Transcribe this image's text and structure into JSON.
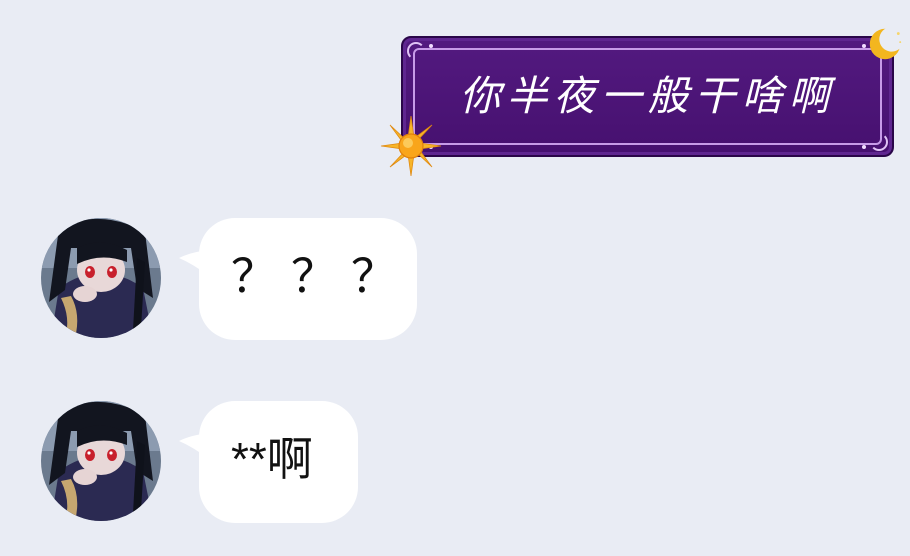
{
  "chat": {
    "outgoing": {
      "text": "你半夜一般干啥啊",
      "bubble_style": "purple-ornate",
      "decorations": [
        "moon-icon",
        "sun-icon"
      ]
    },
    "incoming": [
      {
        "text": "？？？",
        "avatar": "anime-girl-avatar"
      },
      {
        "text": "**啊",
        "avatar": "anime-girl-avatar"
      }
    ]
  },
  "colors": {
    "background": "#e9ecf4",
    "outgoing_bubble": "#4c1478",
    "incoming_bubble": "#ffffff",
    "sun": "#f6a31b",
    "moon": "#f3b61f"
  }
}
